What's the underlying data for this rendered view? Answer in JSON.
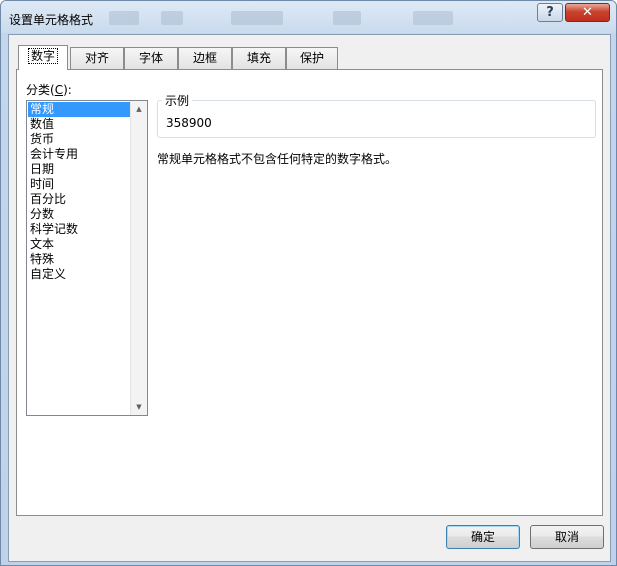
{
  "window": {
    "title": "设置单元格格式",
    "help_label": "?",
    "close_label": "✕"
  },
  "tabs": [
    {
      "label": "数字",
      "active": true
    },
    {
      "label": "对齐",
      "active": false
    },
    {
      "label": "字体",
      "active": false
    },
    {
      "label": "边框",
      "active": false
    },
    {
      "label": "填充",
      "active": false
    },
    {
      "label": "保护",
      "active": false
    }
  ],
  "category": {
    "label_prefix": "分类(",
    "accel": "C",
    "label_suffix": "):",
    "items": [
      "常规",
      "数值",
      "货币",
      "会计专用",
      "日期",
      "时间",
      "百分比",
      "分数",
      "科学记数",
      "文本",
      "特殊",
      "自定义"
    ],
    "selected": "常规"
  },
  "sample": {
    "legend": "示例",
    "value": "358900"
  },
  "description": "常规单元格格式不包含任何特定的数字格式。",
  "buttons": {
    "ok": "确定",
    "cancel": "取消"
  }
}
